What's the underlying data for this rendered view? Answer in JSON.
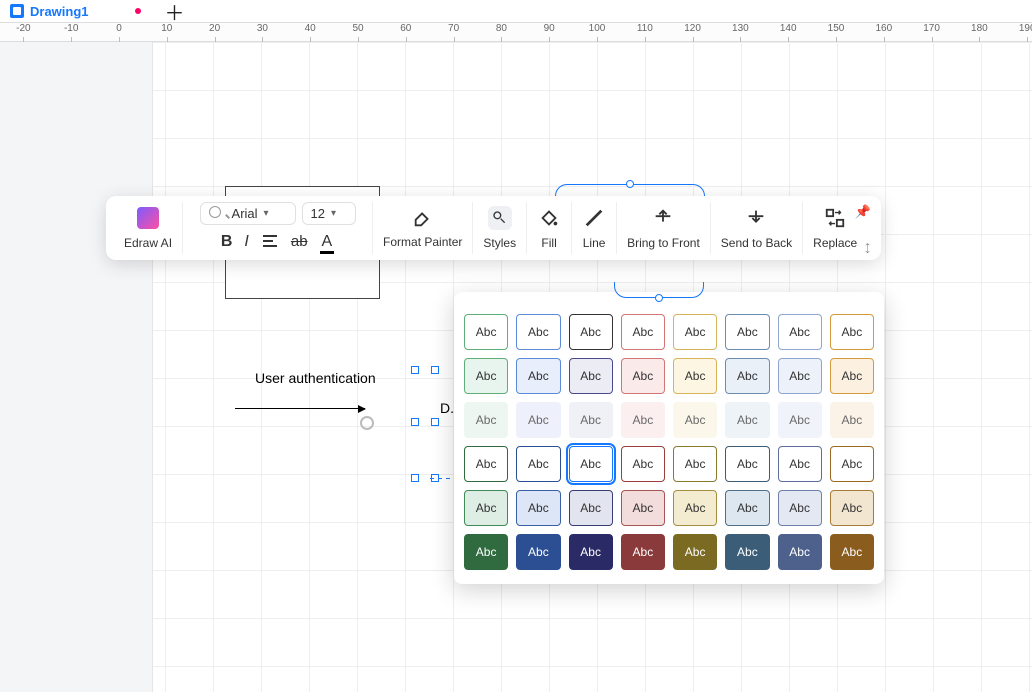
{
  "tab": {
    "title": "Drawing1"
  },
  "ruler": {
    "start": -20,
    "end": 190,
    "step": 10,
    "pxPerUnit": 4.78,
    "originPx": 119
  },
  "toolbar": {
    "ai_label": "Edraw AI",
    "font": {
      "name": "Arial",
      "size": "12"
    },
    "format_painter": "Format Painter",
    "styles": "Styles",
    "fill": "Fill",
    "line": "Line",
    "bring_front": "Bring to Front",
    "send_back": "Send to Back",
    "replace": "Replace"
  },
  "canvas": {
    "auth_text": "User authentication",
    "partial_label": "D."
  },
  "swatch_text": "Abc",
  "styles_grid": [
    [
      {
        "bg": "#ffffff",
        "bd": "#5fae78",
        "fg": "#333333"
      },
      {
        "bg": "#ffffff",
        "bd": "#5b8bd6",
        "fg": "#333333"
      },
      {
        "bg": "#ffffff",
        "bd": "#333333",
        "fg": "#333333"
      },
      {
        "bg": "#ffffff",
        "bd": "#d17575",
        "fg": "#333333"
      },
      {
        "bg": "#ffffff",
        "bd": "#d6b45a",
        "fg": "#333333"
      },
      {
        "bg": "#ffffff",
        "bd": "#6b8db0",
        "fg": "#333333"
      },
      {
        "bg": "#ffffff",
        "bd": "#8fa6cf",
        "fg": "#333333"
      },
      {
        "bg": "#ffffff",
        "bd": "#d59a3e",
        "fg": "#333333"
      }
    ],
    [
      {
        "bg": "#e8f4ee",
        "bd": "#5fae78",
        "fg": "#333333"
      },
      {
        "bg": "#e8eefc",
        "bd": "#5b8bd6",
        "fg": "#333333"
      },
      {
        "bg": "#ececf4",
        "bd": "#4a4a8a",
        "fg": "#333333"
      },
      {
        "bg": "#fbeaea",
        "bd": "#d17575",
        "fg": "#333333"
      },
      {
        "bg": "#fcf6e3",
        "bd": "#d6b45a",
        "fg": "#333333"
      },
      {
        "bg": "#e9f0f8",
        "bd": "#6b8db0",
        "fg": "#333333"
      },
      {
        "bg": "#edf1fa",
        "bd": "#8fa6cf",
        "fg": "#333333"
      },
      {
        "bg": "#fcf1e1",
        "bd": "#d59a3e",
        "fg": "#333333"
      }
    ],
    [
      {
        "bg": "#eef6f1",
        "bd": "#eef6f1",
        "fg": "#6a6a6a"
      },
      {
        "bg": "#eef1fb",
        "bd": "#eef1fb",
        "fg": "#6a6a6a"
      },
      {
        "bg": "#f0f0f7",
        "bd": "#f0f0f7",
        "fg": "#6a6a6a"
      },
      {
        "bg": "#fbefef",
        "bd": "#fbefef",
        "fg": "#6a6a6a"
      },
      {
        "bg": "#fbf7ea",
        "bd": "#fbf7ea",
        "fg": "#6a6a6a"
      },
      {
        "bg": "#eef3f8",
        "bd": "#eef3f8",
        "fg": "#6a6a6a"
      },
      {
        "bg": "#f1f3fa",
        "bd": "#f1f3fa",
        "fg": "#6a6a6a"
      },
      {
        "bg": "#fbf3e8",
        "bd": "#fbf3e8",
        "fg": "#6a6a6a"
      }
    ],
    [
      {
        "bg": "#ffffff",
        "bd": "#2f6b3f",
        "fg": "#333333"
      },
      {
        "bg": "#ffffff",
        "bd": "#2c4f93",
        "fg": "#333333"
      },
      {
        "bg": "#ffffff",
        "bd": "#1677ff",
        "fg": "#333333",
        "sel": true
      },
      {
        "bg": "#ffffff",
        "bd": "#9a3d3d",
        "fg": "#333333"
      },
      {
        "bg": "#ffffff",
        "bd": "#8a7a2e",
        "fg": "#333333"
      },
      {
        "bg": "#ffffff",
        "bd": "#3c5d77",
        "fg": "#333333"
      },
      {
        "bg": "#ffffff",
        "bd": "#5e709a",
        "fg": "#333333"
      },
      {
        "bg": "#ffffff",
        "bd": "#9a6a22",
        "fg": "#333333"
      }
    ],
    [
      {
        "bg": "#dfeee5",
        "bd": "#3f8a57",
        "fg": "#333333"
      },
      {
        "bg": "#dde6f6",
        "bd": "#3a5fa8",
        "fg": "#333333"
      },
      {
        "bg": "#e2e4ef",
        "bd": "#3c3c78",
        "fg": "#333333"
      },
      {
        "bg": "#f3dcdc",
        "bd": "#a85454",
        "fg": "#333333"
      },
      {
        "bg": "#f3ecd1",
        "bd": "#a3903e",
        "fg": "#333333"
      },
      {
        "bg": "#dde7ef",
        "bd": "#4f6e88",
        "fg": "#333333"
      },
      {
        "bg": "#e3e8f3",
        "bd": "#6e80aa",
        "fg": "#333333"
      },
      {
        "bg": "#f3e6d1",
        "bd": "#a87a36",
        "fg": "#333333"
      }
    ],
    [
      {
        "bg": "#2f6b3f",
        "bd": "#2f6b3f",
        "fg": "#ffffff"
      },
      {
        "bg": "#2c4f93",
        "bd": "#2c4f93",
        "fg": "#ffffff"
      },
      {
        "bg": "#2a2a66",
        "bd": "#2a2a66",
        "fg": "#ffffff"
      },
      {
        "bg": "#8a3a3a",
        "bd": "#8a3a3a",
        "fg": "#ffffff"
      },
      {
        "bg": "#7a6a22",
        "bd": "#7a6a22",
        "fg": "#ffffff"
      },
      {
        "bg": "#3c5d77",
        "bd": "#3c5d77",
        "fg": "#ffffff"
      },
      {
        "bg": "#4e608c",
        "bd": "#4e608c",
        "fg": "#ffffff"
      },
      {
        "bg": "#8a5c1e",
        "bd": "#8a5c1e",
        "fg": "#ffffff"
      }
    ]
  ]
}
